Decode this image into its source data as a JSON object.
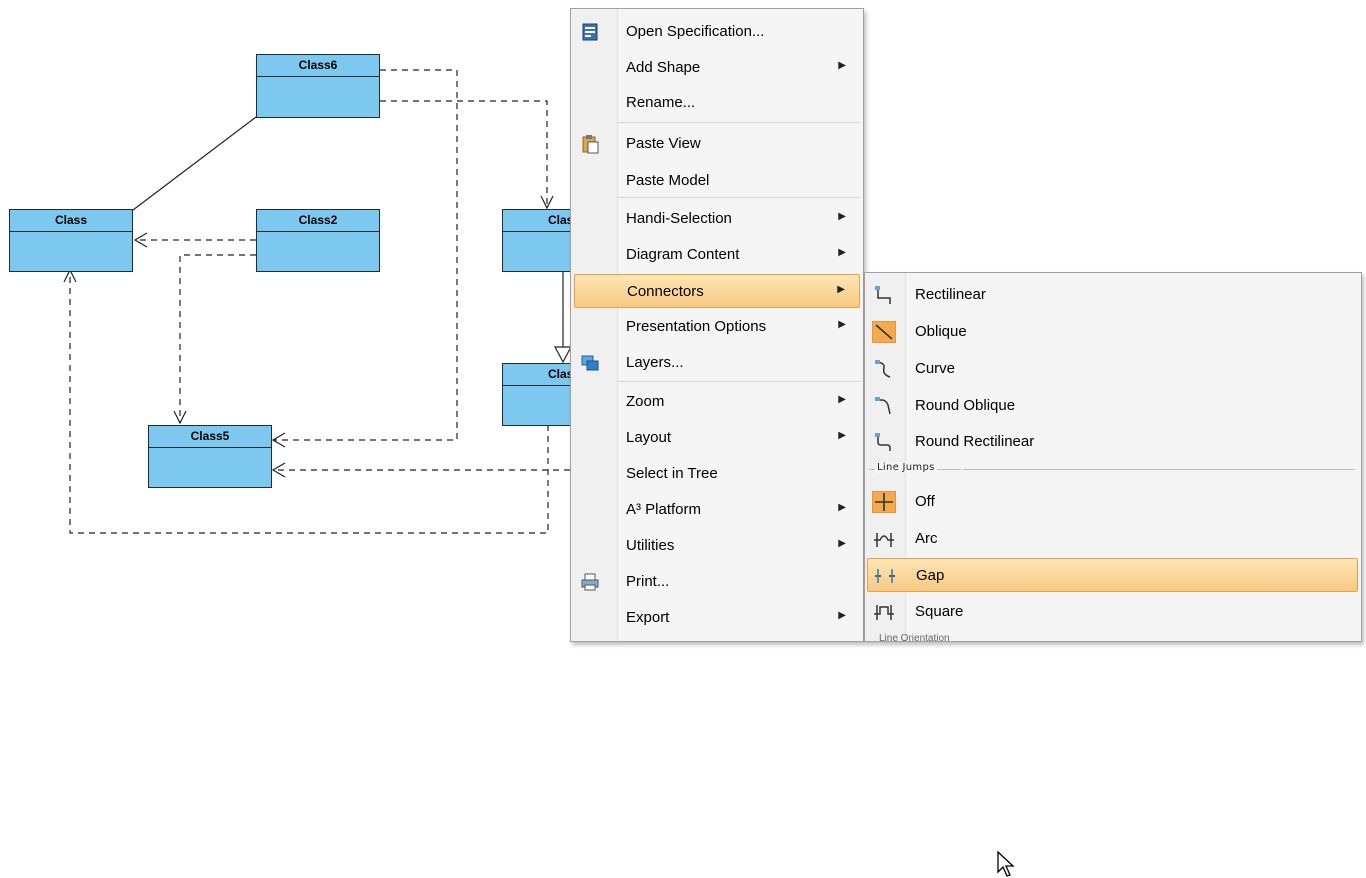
{
  "diagram": {
    "classes": [
      {
        "id": "class6",
        "name": "Class6"
      },
      {
        "id": "class",
        "name": "Class"
      },
      {
        "id": "class2",
        "name": "Class2"
      },
      {
        "id": "class-mid-top",
        "name": "Class"
      },
      {
        "id": "class-mid-bottom",
        "name": "Class"
      },
      {
        "id": "class5",
        "name": "Class5"
      }
    ]
  },
  "context_menu": {
    "items": [
      {
        "label": "Open Specification...",
        "icon": "specification-icon",
        "submenu": false
      },
      {
        "label": "Add Shape",
        "submenu": true
      },
      {
        "label": "Rename...",
        "submenu": false
      },
      {
        "label": "Paste View",
        "icon": "paste-icon",
        "submenu": false
      },
      {
        "label": "Paste Model",
        "submenu": false
      },
      {
        "label": "Handi-Selection",
        "submenu": true
      },
      {
        "label": "Diagram Content",
        "submenu": true
      },
      {
        "label": "Connectors",
        "submenu": true,
        "highlighted": true
      },
      {
        "label": "Presentation Options",
        "submenu": true
      },
      {
        "label": "Layers...",
        "icon": "layers-icon",
        "submenu": false
      },
      {
        "label": "Zoom",
        "submenu": true
      },
      {
        "label": "Layout",
        "submenu": true
      },
      {
        "label": "Select in Tree",
        "submenu": false
      },
      {
        "label": "A³ Platform",
        "submenu": true
      },
      {
        "label": "Utilities",
        "submenu": true
      },
      {
        "label": "Print...",
        "icon": "print-icon",
        "submenu": false
      },
      {
        "label": "Export",
        "submenu": true
      }
    ],
    "submenu_arrow": "▶"
  },
  "connectors_submenu": {
    "items": [
      {
        "label": "Rectilinear",
        "icon": "rectilinear-connector-icon"
      },
      {
        "label": "Oblique",
        "icon": "oblique-connector-icon",
        "checked": true
      },
      {
        "label": "Curve",
        "icon": "curve-connector-icon"
      },
      {
        "label": "Round Oblique",
        "icon": "round-oblique-connector-icon"
      },
      {
        "label": "Round Rectilinear",
        "icon": "round-rectilinear-connector-icon"
      }
    ],
    "line_jumps_caption": "Line Jumps",
    "line_jumps": [
      {
        "label": "Off",
        "icon": "line-jump-off-icon",
        "checked": true
      },
      {
        "label": "Arc",
        "icon": "line-jump-arc-icon"
      },
      {
        "label": "Gap",
        "icon": "line-jump-gap-icon",
        "hovered": true
      },
      {
        "label": "Square",
        "icon": "line-jump-square-icon"
      }
    ],
    "cut_caption": "Line Orientation"
  },
  "colors": {
    "class_fill": "#7cc8ef",
    "menu_background": "#f5f5f5",
    "highlight": "#f8c983",
    "highlight_border": "#e3a24a",
    "checked_icon_bg": "#f4a94c"
  }
}
